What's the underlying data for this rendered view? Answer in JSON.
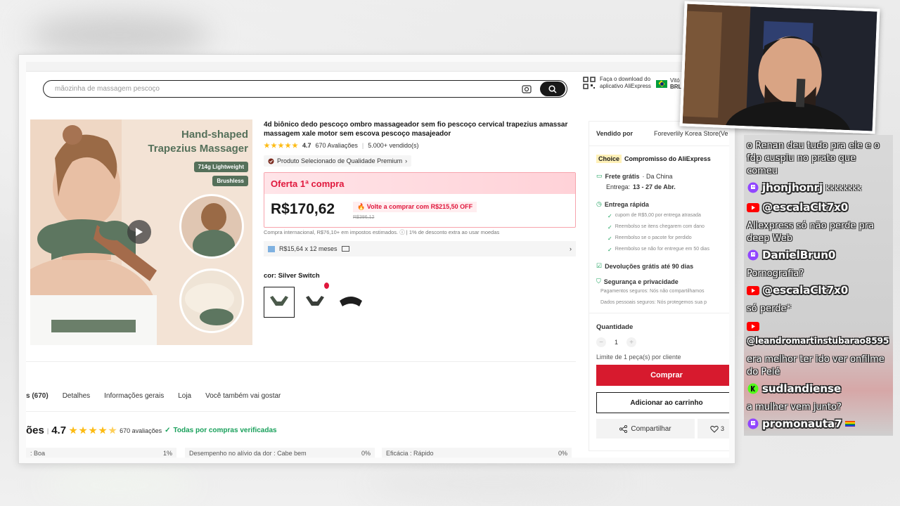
{
  "search": {
    "placeholder": "mãozinha de massagem pescoço"
  },
  "header": {
    "app_download": "Faça o download do aplicativo AliExpress",
    "region_short": "Vitó",
    "currency": "BRL"
  },
  "product_image": {
    "title_line1": "Hand-shaped",
    "title_line2": "Trapezius Massager",
    "badge1": "714g Lightweight",
    "badge2": "Brushless"
  },
  "product": {
    "title": "4d biônico dedo pescoço ombro massageador sem fio pescoço cervical trapezius amassar massagem xale motor sem escova pescoço masajeador",
    "rating": "4.7",
    "rating_value": 4.7,
    "reviews": "670 Avaliações",
    "sold": "5.000+ vendido(s)",
    "premium": "Produto Selecionado de Qualidade Premium",
    "offer_label": "Oferta 1ª compra",
    "price": "R$170,62",
    "volte": "Volte a comprar com R$215,50 OFF",
    "old_price": "R$386,12",
    "tax_note": "Compra internacional, R$76,10+ em impostos estimados. ⓘ  |  1% de desconto extra ao usar moedas",
    "installments": "R$15,64 x 12 meses",
    "color_label": "cor: Silver Switch"
  },
  "tabs": [
    "s (670)",
    "Detalhes",
    "Informações gerais",
    "Loja",
    "Você também vai gostar"
  ],
  "reviews_summary": {
    "heading": "ões",
    "score": "4.7",
    "count": "670 avaliações",
    "verified": "Todas por compras verificadas"
  },
  "review_bars": [
    {
      "label": ": Boa",
      "pct": "1%"
    },
    {
      "label": "Desempenho no alívio da dor : Cabe bem",
      "pct": "0%"
    },
    {
      "label": "Eficácia : Rápido",
      "pct": "0%"
    }
  ],
  "sidebar": {
    "sold_by_label": "Vendido por",
    "store": "Foreverlily Korea Store(Ve",
    "choice_badge": "Choice",
    "choice_text": "Compromisso do AliExpress",
    "free_ship": "Frete grátis",
    "free_ship_origin": "· Da China",
    "delivery_label": "Entrega:",
    "delivery_dates": "13 - 27 de Abr.",
    "fast_delivery": "Entrega rápida",
    "fast_items": [
      "cupom de R$5,00 por entrega atrasada",
      "Reembolso se itens chegarem com dano",
      "Reembolso se o pacote for perdido",
      "Reembolso se não for entregue em 50 dias"
    ],
    "returns": "Devoluções grátis até 90 dias",
    "security": "Segurança e privacidade",
    "security_items": [
      "Pagamentos seguros: Nós não compartilhamos",
      "Dados pessoais seguros: Nós protegemos sua p"
    ],
    "qty_label": "Quantidade",
    "qty_value": "1",
    "limit": "Limite de 1 peça(s) por cliente",
    "buy": "Comprar",
    "cart": "Adicionar ao carrinho",
    "share": "Compartilhar",
    "fav_count": "3"
  },
  "chat": [
    {
      "platform": "none",
      "user": "",
      "text": "o Renan deu tudo pra ele e o fdp cuspiu no prato que comeu"
    },
    {
      "platform": "twitch",
      "user": "jhonjhonrj",
      "text": "kkkkkkkk"
    },
    {
      "platform": "youtube",
      "user": "@escalaClt7x0",
      "text": "Aliexpress só não perde pra deep Web"
    },
    {
      "platform": "twitch",
      "user": "DanielBrun0",
      "text": "Pornografia?"
    },
    {
      "platform": "youtube",
      "user": "@escalaClt7x0",
      "text": "só perde*"
    },
    {
      "platform": "youtube",
      "user": "@leandromartinstubarao8595",
      "text": "era melhor ter ido ver onfilme do Pelé"
    },
    {
      "platform": "kick",
      "user": "sudlandiense",
      "text": "a mulher vem junto?"
    },
    {
      "platform": "twitch",
      "user": "promonauta7",
      "text": ""
    }
  ],
  "colors": {
    "accent": "#d71a2e",
    "offer": "#e0173c",
    "twitch": "#9146ff",
    "youtube": "#ff0000",
    "kick": "#53fc18",
    "verified": "#19a05b"
  }
}
